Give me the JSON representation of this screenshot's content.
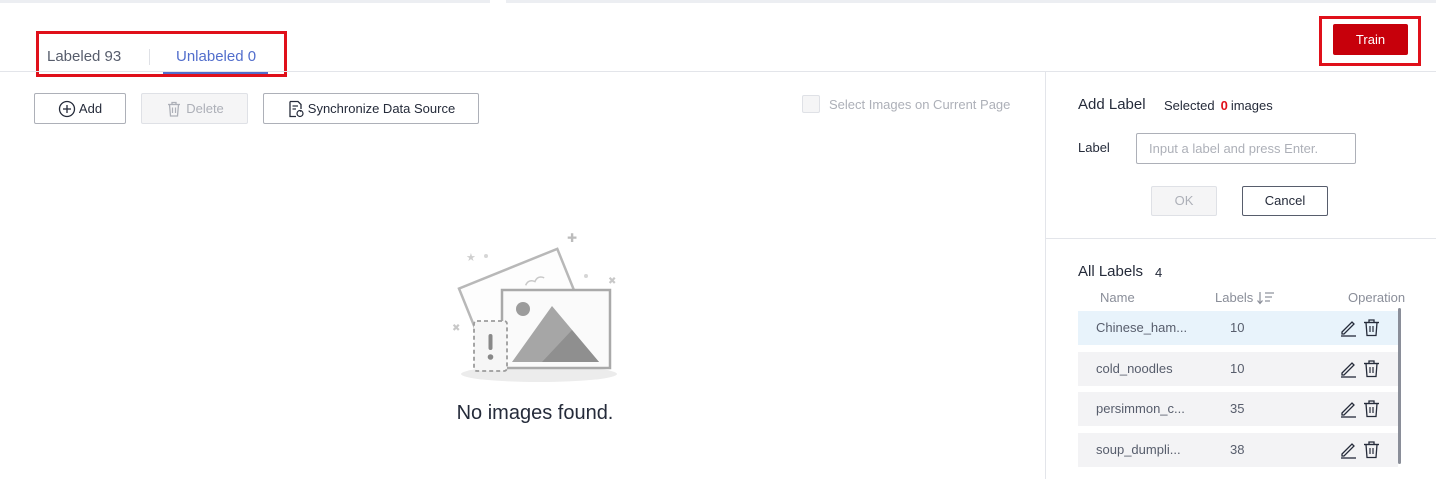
{
  "tabs": {
    "labeled": "Labeled 93",
    "unlabeled": "Unlabeled 0"
  },
  "header": {
    "train_label": "Train"
  },
  "toolbar": {
    "add_label": "Add",
    "delete_label": "Delete",
    "sync_label": "Synchronize Data Source",
    "select_page_label": "Select Images on Current Page"
  },
  "empty": {
    "message": "No images found."
  },
  "add_label_panel": {
    "title": "Add Label",
    "selected_prefix": "Selected",
    "selected_count": "0",
    "selected_suffix": "images",
    "field_label": "Label",
    "input_placeholder": "Input a label and press Enter.",
    "input_value": "",
    "ok_label": "OK",
    "cancel_label": "Cancel"
  },
  "all_labels": {
    "title": "All Labels",
    "count": "4",
    "columns": {
      "name": "Name",
      "labels": "Labels",
      "operation": "Operation"
    },
    "rows": [
      {
        "name": "Chinese_ham...",
        "labels": "10"
      },
      {
        "name": "cold_noodles",
        "labels": "10"
      },
      {
        "name": "persimmon_c...",
        "labels": "35"
      },
      {
        "name": "soup_dumpli...",
        "labels": "38"
      }
    ]
  },
  "icons": {
    "add": "plus-circle-icon",
    "delete": "trash-icon",
    "sync": "sync-document-icon",
    "sort": "sort-icon",
    "edit": "pencil-icon",
    "row_delete": "trash-icon",
    "empty": "empty-images-illustration"
  },
  "colors": {
    "accent": "#526ecc",
    "primary": "#c7000b",
    "highlight": "#e0101a",
    "row_active": "#e8f3fb"
  }
}
